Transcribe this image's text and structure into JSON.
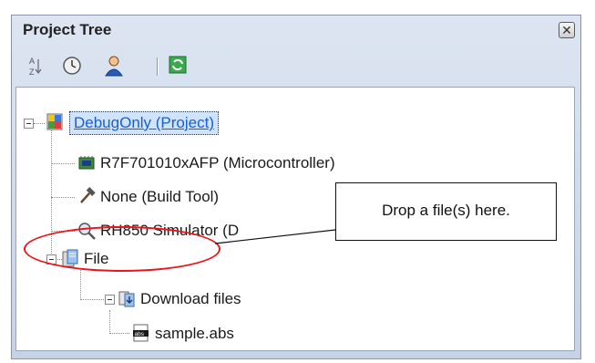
{
  "panel": {
    "title": "Project Tree",
    "close_glyph": "✕"
  },
  "toolbar": {
    "buttons": [
      {
        "icon": "sort-az-icon",
        "glyph": "A↓Z"
      },
      {
        "icon": "clock-icon",
        "glyph": ""
      },
      {
        "icon": "user-icon",
        "glyph": ""
      },
      {
        "icon": "refresh-icon",
        "glyph": ""
      }
    ]
  },
  "tree": {
    "project": {
      "label": "DebugOnly (Project)",
      "icon": "project-icon"
    },
    "children": [
      {
        "label": "R7F701010xAFP (Microcontroller)",
        "icon": "microcontroller-icon"
      },
      {
        "label": "None (Build Tool)",
        "icon": "hammer-icon"
      },
      {
        "label": "RH850 Simulator (D",
        "icon": "simulator-icon"
      },
      {
        "label": "File",
        "icon": "file-folder-icon"
      }
    ],
    "file_children": [
      {
        "label": "Download files",
        "icon": "download-files-icon"
      }
    ],
    "download_children": [
      {
        "label": "sample.abs",
        "icon": "abs-file-icon",
        "badge": "abs"
      }
    ]
  },
  "callout": {
    "text": "Drop a file(s) here."
  },
  "colors": {
    "highlight": "#e8161b",
    "selection": "#cfe3ff",
    "link": "#1a5fd0"
  }
}
